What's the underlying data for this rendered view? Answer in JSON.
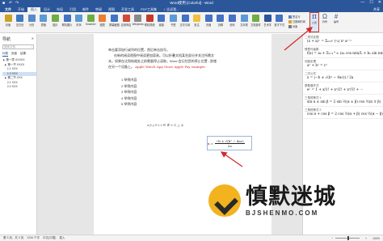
{
  "window": {
    "title": "Word使用 [Colorful] - Word",
    "controls": [
      "—",
      "☐",
      "✕"
    ]
  },
  "tabs": [
    {
      "label": "文件",
      "active": false
    },
    {
      "label": "开始",
      "active": false
    },
    {
      "label": "插入",
      "active": true
    },
    {
      "label": "设计",
      "active": false
    },
    {
      "label": "布局",
      "active": false
    },
    {
      "label": "引用",
      "active": false
    },
    {
      "label": "邮件",
      "active": false
    },
    {
      "label": "审阅",
      "active": false
    },
    {
      "label": "视图",
      "active": false
    },
    {
      "label": "开发工具",
      "active": false
    },
    {
      "label": "PDF工具集",
      "active": false
    },
    {
      "label": "♀ 告诉我...",
      "active": false
    }
  ],
  "tabs_right": "共享",
  "ribbon": {
    "buttons": [
      "封面",
      "空白页",
      "分页",
      "表格",
      "图片",
      "联机图片",
      "形状",
      "SmartArt",
      "图表",
      "屏幕截图",
      "应用商店",
      "Wikipedia",
      "联机视频",
      "链接",
      "书签",
      "交叉引用",
      "批注",
      "页眉",
      "页脚",
      "页码",
      "文本框",
      "文档部件",
      "艺术字",
      "首字下沉"
    ],
    "side_items": [
      "签名行",
      "日期和时间",
      "对象"
    ],
    "equation_label": "公式",
    "symbol_label": "符号",
    "extra_label": "编号",
    "colors": {
      "accent": "#2b579a",
      "highlight_border": "#c43b2a"
    }
  },
  "nav": {
    "title": "导航",
    "search_placeholder": "搜索文档",
    "tabs": [
      "标题",
      "页面",
      "结果"
    ],
    "tree": [
      "▲ 第一章 XXXXX",
      "  ▲ 第一节 XXXX",
      "      1.1 XXX",
      "      1.2 XXX",
      "  ▲ 第二节 XXX",
      "      2.1 XXX",
      "      2.2 XXX"
    ],
    "selected_index": 3
  },
  "doc": {
    "lines": [
      "单击要添加行或列的位置，然后单击加号。",
      "在新的阅读视图中阅读更加容易。可以折叠文档某些部分并关注所需文",
      "本。如果在达到结尾处之前需要停止读取，Word 会记住您的停止位置 - 即使",
      "在另一个设备上。"
    ],
    "red_words": "Apple Watch   App Store   Apple Pay   example",
    "list": [
      "1 举例内容",
      "2 举例内容",
      "3 举例内容",
      "4 举例内容",
      "5 举例内容"
    ],
    "math_symbols": "α β γ δ  ≥ ≤ ∈ ∉  ∞  ⊆  △  ◎",
    "formula_lhs": "x =",
    "formula_num": "−b ± √(b² − 4ac)",
    "formula_den": "2a"
  },
  "equations": [
    {
      "name": "二项式定理",
      "expr": "(x + a)ⁿ = Σₖ₌₀ⁿ (ⁿₖ) xᵏ aⁿ⁻ᵏ"
    },
    {
      "name": "傅里叶级数",
      "expr": "f(x) = a₀ + Σₙ₌₁^∞ (aₙ cos nπx/L + bₙ sin nπx/L)"
    },
    {
      "name": "勾股定理",
      "expr": "a² + b² = c²"
    },
    {
      "name": "二次公式",
      "expr": "x = (−b ± √(b² − 4ac)) / 2a"
    },
    {
      "name": "泰勒展开式",
      "expr": "eˣ = 1 + x/1! + x²/2! + x³/3! + ⋯"
    },
    {
      "name": "三角恒等式 1",
      "expr": "sin α ± sin β = 2 sin ½(α ± β) cos ½(α ∓ β)"
    },
    {
      "name": "三角恒等式 2",
      "expr": "cos α + cos β = 2 cos ½(α + β) cos ½(α − β)"
    }
  ],
  "status": {
    "page": "第 3 页，共 4 页",
    "words": "1234 个字",
    "lang": "中文(中国)",
    "mode": "插入",
    "zoom": "100%"
  },
  "watermark": {
    "big": "慎默迷城",
    "small": "BJSHENMO.COM"
  }
}
